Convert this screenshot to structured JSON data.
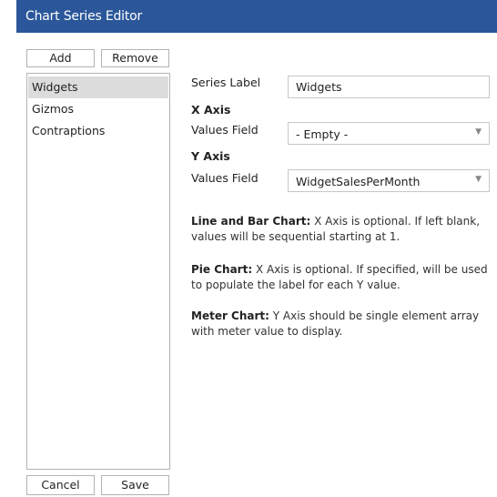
{
  "window": {
    "title": "Chart Series Editor"
  },
  "toolbar": {
    "add_label": "Add",
    "remove_label": "Remove"
  },
  "series_list": {
    "items": [
      {
        "label": "Widgets",
        "selected": true
      },
      {
        "label": "Gizmos",
        "selected": false
      },
      {
        "label": "Contraptions",
        "selected": false
      }
    ]
  },
  "form": {
    "series_label": {
      "label": "Series Label",
      "value": "Widgets"
    },
    "x_axis": {
      "heading": "X Axis",
      "values_field_label": "Values Field",
      "selected": "- Empty -"
    },
    "y_axis": {
      "heading": "Y Axis",
      "values_field_label": "Values Field",
      "selected": "WidgetSalesPerMonth"
    }
  },
  "help": [
    {
      "title": "Line and Bar Chart:",
      "text": " X Axis is optional. If left blank, values will be sequential starting at 1."
    },
    {
      "title": "Pie Chart:",
      "text": " X Axis is optional. If specified, will be used to populate the label for each Y value."
    },
    {
      "title": "Meter Chart:",
      "text": " Y Axis should be single element array with meter value to display."
    }
  ],
  "footer": {
    "cancel_label": "Cancel",
    "save_label": "Save"
  },
  "colors": {
    "titlebar": "#2b579a",
    "selected_row": "#dcdcdc",
    "border": "#b3b3b3"
  }
}
